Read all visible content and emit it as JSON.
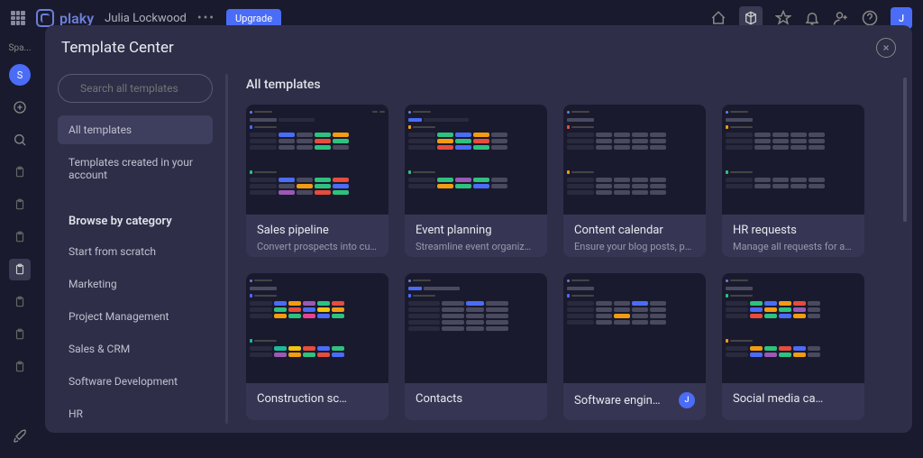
{
  "app": {
    "name": "plaky",
    "user": "Julia Lockwood",
    "upgrade": "Upgrade",
    "avatar_initial": "J"
  },
  "sidenav": {
    "label": "Spa...",
    "circle": "S"
  },
  "modal": {
    "title": "Template Center",
    "search_placeholder": "Search all templates",
    "side_items": {
      "all": "All templates",
      "created": "Templates created in your account"
    },
    "category_heading": "Browse by category",
    "categories": [
      "Start from scratch",
      "Marketing",
      "Project Management",
      "Sales & CRM",
      "Software Development",
      "HR"
    ],
    "main_heading": "All templates",
    "templates": [
      {
        "title": "Sales pipeline",
        "desc": "Convert prospects into cust…"
      },
      {
        "title": "Event planning",
        "desc": "Streamline event organizati…"
      },
      {
        "title": "Content calendar",
        "desc": "Ensure your blog posts, pub…"
      },
      {
        "title": "HR requests",
        "desc": "Manage all requests for a v…"
      },
      {
        "title": "Construction sc…",
        "desc": ""
      },
      {
        "title": "Contacts",
        "desc": ""
      },
      {
        "title": "Software engin…",
        "desc": "",
        "avatar": "J"
      },
      {
        "title": "Social media ca…",
        "desc": ""
      }
    ]
  }
}
